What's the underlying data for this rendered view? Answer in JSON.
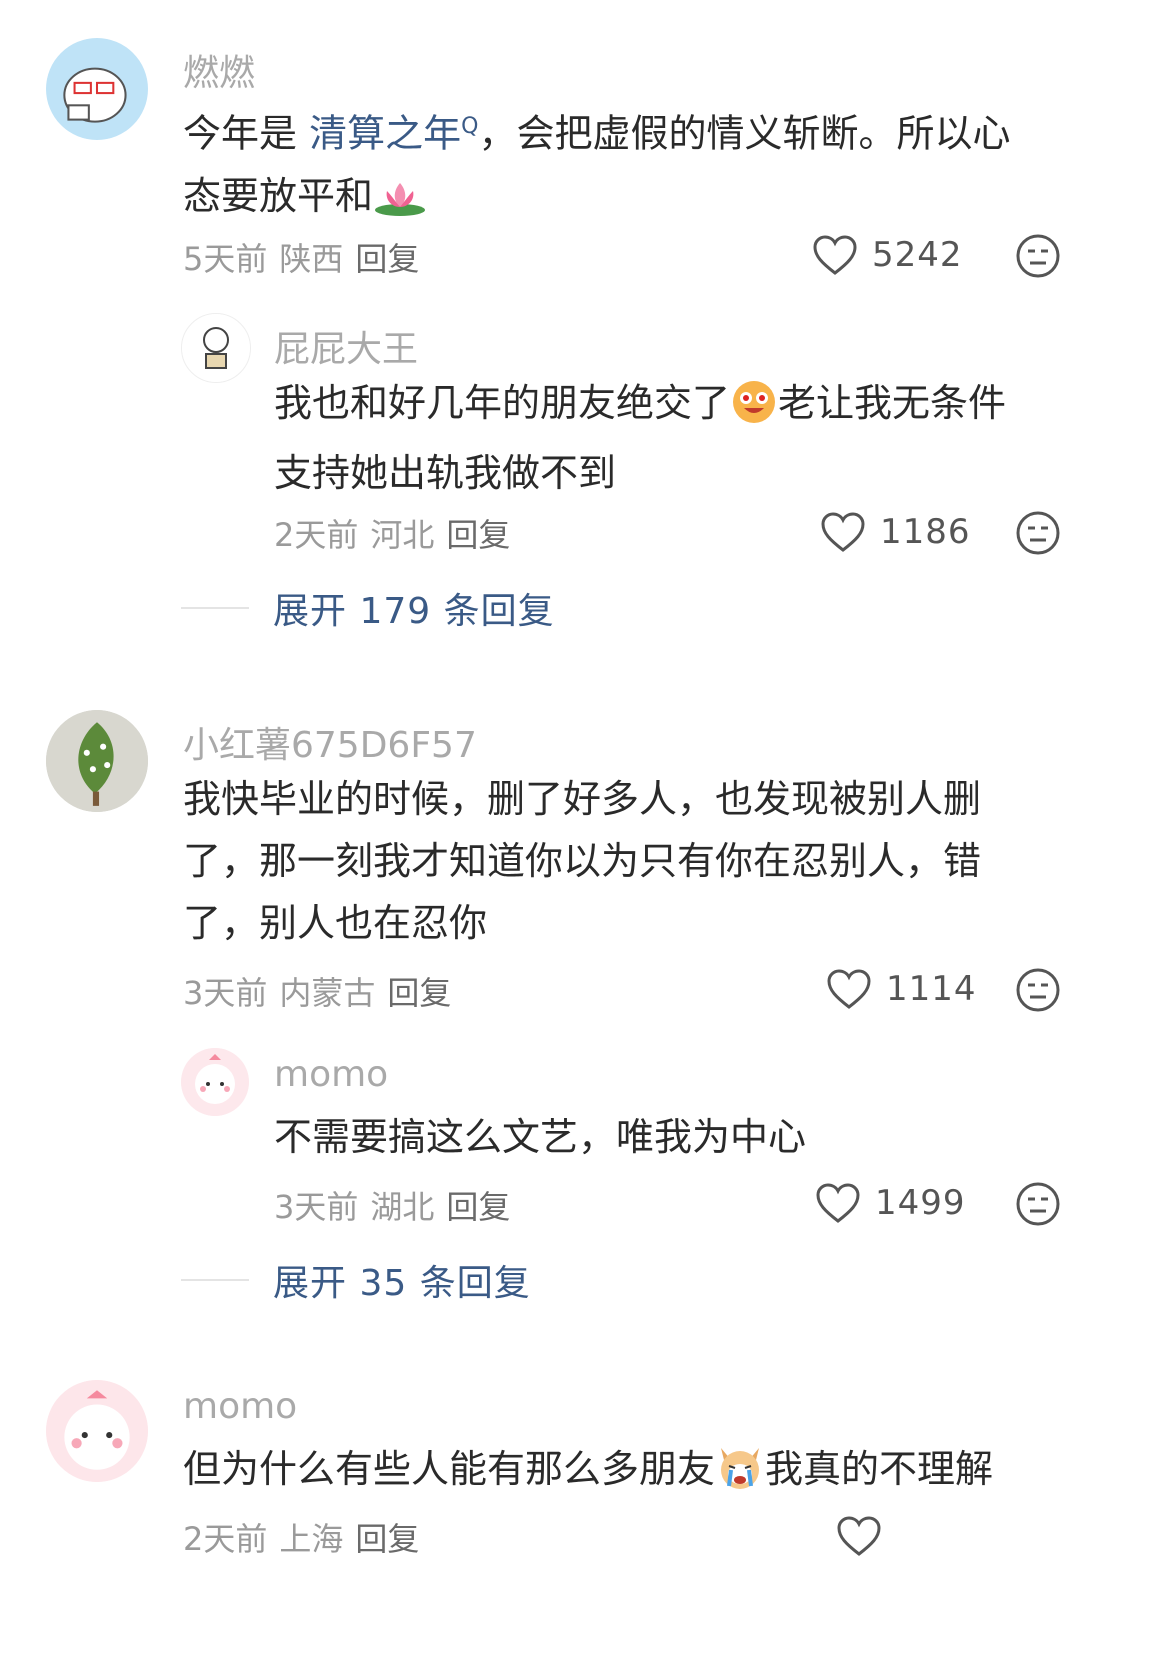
{
  "comments": [
    {
      "name": "燃燃",
      "text_pre": "今年是 ",
      "link": "清算之年",
      "link_sup": "Q",
      "text_post_line1": "，会把虚假的情义斩断。所以心",
      "line2": "态要放平和",
      "emoji": "lotus",
      "time": "5天前",
      "location": "陕西",
      "reply": "回复",
      "likes": "5242",
      "replies": [
        {
          "name": "屁屁大王",
          "line1_pre": "我也和好几年的朋友绝交了",
          "line1_post": "老让我无条件",
          "line2": "支持她出轨我做不到",
          "time": "2天前",
          "location": "河北",
          "reply": "回复",
          "likes": "1186"
        }
      ],
      "expand": "展开 179 条回复"
    },
    {
      "name": "小红薯675D6F57",
      "line1": "我快毕业的时候，删了好多人，也发现被别人删",
      "line2": "了，那一刻我才知道你以为只有你在忍别人，错",
      "line3": "了，别人也在忍你",
      "time": "3天前",
      "location": "内蒙古",
      "reply": "回复",
      "likes": "1114",
      "replies": [
        {
          "name": "momo",
          "line1": "不需要搞这么文艺，唯我为中心",
          "time": "3天前",
          "location": "湖北",
          "reply": "回复",
          "likes": "1499"
        }
      ],
      "expand": "展开 35 条回复"
    },
    {
      "name": "momo",
      "line1_pre": "但为什么有些人能有那么多朋友",
      "line1_post": "我真的不理解",
      "time": "2天前",
      "location": "上海",
      "reply": "回复"
    }
  ],
  "icons": {
    "like": "heart-outline-icon",
    "dislike": "meh-face-icon"
  },
  "colors": {
    "link": "#3a5a86",
    "name": "#a9a9a9",
    "text": "#2a2a2a",
    "meta": "#9a9a9a"
  }
}
